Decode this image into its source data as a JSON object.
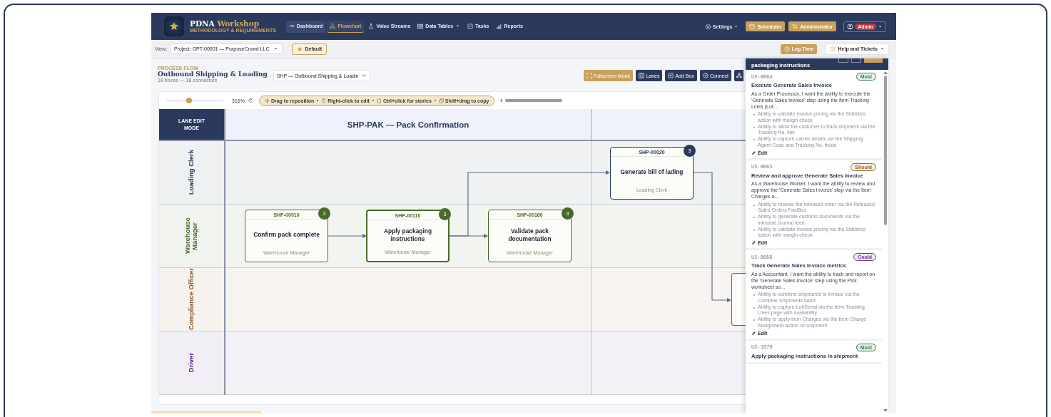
{
  "header": {
    "brand": {
      "name": "PDNA",
      "accent": "Workshop",
      "tagline": "METHODOLOGY & REQUIREMENTS"
    },
    "nav": [
      {
        "label": "Dashboard",
        "selected": false,
        "highlighted": true,
        "dropdown": false
      },
      {
        "label": "Flowchart",
        "selected": true,
        "highlighted": false,
        "dropdown": false
      },
      {
        "label": "Value Streams",
        "selected": false,
        "highlighted": false,
        "dropdown": false
      },
      {
        "label": "Data Tables",
        "selected": false,
        "highlighted": false,
        "dropdown": true
      },
      {
        "label": "Tasks",
        "selected": false,
        "highlighted": false,
        "dropdown": false
      },
      {
        "label": "Reports",
        "selected": false,
        "highlighted": false,
        "dropdown": false
      }
    ],
    "settings": "Settings",
    "buttons": [
      "Scheduler",
      "Administrator"
    ],
    "user_badge": "Admin"
  },
  "toolbar": {
    "view_label": "View:",
    "view_value": "Project: OPT-00001 — PurposeCrowd LLC",
    "default_button": "Default",
    "log_time": "Log Time",
    "help": "Help and Tickets"
  },
  "page": {
    "eyebrow": "PROCESS FLOW",
    "title": "Outbound Shipping & Loading",
    "subtitle": "18 boxes — 18 connectors",
    "stream_select": "SHP — Outbound Shipping & Loadin",
    "actions": [
      {
        "label": "Fullscreen Mode",
        "kind": "accent"
      },
      {
        "label": "Lanes",
        "kind": "primary"
      },
      {
        "label": "Add Box",
        "kind": "primary"
      },
      {
        "label": "Connect",
        "kind": "primary"
      },
      {
        "kind": "primary"
      }
    ]
  },
  "canvas": {
    "zoom": {
      "level": 0.4,
      "reading": "316%"
    },
    "hints": [
      "Drag to reposition",
      "Right-click to edit",
      "Ctrl+click for stories",
      "Shift+drag to copy"
    ],
    "lane_header": "LANE EDIT MODE",
    "stages": [
      {
        "title": "SHP-PAK — Pack Confirmation"
      }
    ],
    "lanes": [
      {
        "name": "Loading Clerk",
        "color": "#2b3a5c",
        "boxes": [
          {
            "id": "SHP-00020",
            "title": "Generate bill of lading",
            "role": "Loading Clerk",
            "count": "3",
            "selected": false
          }
        ]
      },
      {
        "name": "Warehouse Manager",
        "color": "#4a6a2a",
        "boxes": [
          {
            "id": "SHP-00010",
            "title": "Confirm pack complete",
            "role": "Warehouse Manager",
            "count": "3",
            "selected": false
          },
          {
            "id": "SHP-00110",
            "title": "Apply packaging instructions",
            "role": "Warehouse Manager",
            "count": "3",
            "selected": true
          },
          {
            "id": "SHP-00160",
            "title": "Validate pack documentation",
            "role": "Warehouse Manager",
            "count": "3",
            "selected": false
          }
        ]
      },
      {
        "name": "Compliance Officer",
        "color": "#8a5a2a",
        "boxes": [
          {
            "selected": false
          }
        ]
      },
      {
        "name": "Driver",
        "color": "#5a2a8a"
      }
    ]
  },
  "story_panel": {
    "title": "packaging instructions",
    "stories": [
      {
        "id": "US-0664",
        "priority": "Must",
        "color": "#3d7a4f",
        "title": "Execute Generate Sales Invoice",
        "description": "As a Order Processor, I want the ability to execute the 'Generate Sales Invoice' step using the Item Tracking Lines (Lot...",
        "criteria": [
          "Ability to validate invoice pricing via the Statistics action with margin check",
          "Ability to allow the customer to track shipment via the Tracking No. link",
          "Ability to capture carrier details via the Shipping Agent Code and Tracking No. fields"
        ],
        "edit": "Edit"
      },
      {
        "id": "US-0665",
        "priority": "Should",
        "color": "#9a6a2a",
        "title": "Review and approve Generate Sales Invoice",
        "description": "As a Warehouse Worker, I want the ability to review and approve the 'Generate Sales Invoice' step via the Item Charges a...",
        "criteria": [
          "Ability to receive the released order via the Released Sales Orders FactBox",
          "Ability to generate customs documents via the Intrastat Journal feed",
          "Ability to validate invoice pricing via the Statistics action with margin check"
        ],
        "edit": "Edit"
      },
      {
        "id": "US-0666",
        "priority": "Could",
        "color": "#6a3a9a",
        "title": "Track Generate Sales Invoice metrics",
        "description": "As a Accountant, I want the ability to track and report on the 'Generate Sales Invoice' step using the Pick worksheet so...",
        "criteria": [
          "Ability to combine shipments to invoice via the Combine Shipments batch",
          "Ability to capture Lot/Serial via the Item Tracking Lines page with availability",
          "Ability to apply Item Charges via the Item Charge Assignment action on shipment"
        ],
        "edit": "Edit"
      },
      {
        "id": "US-1879",
        "priority": "Must",
        "color": "#3d7a4f",
        "title": "Apply packaging instructions in shipment"
      }
    ]
  }
}
